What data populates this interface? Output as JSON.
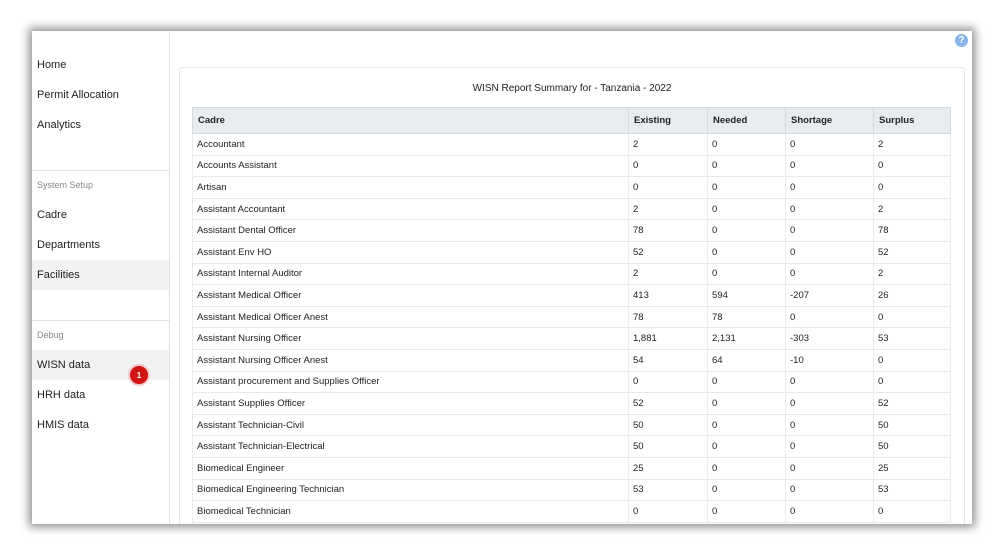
{
  "sidebar": {
    "main_items": [
      {
        "label": "Home"
      },
      {
        "label": "Permit Allocation"
      },
      {
        "label": "Analytics"
      }
    ],
    "system_setup_header": "System Setup",
    "system_setup_items": [
      {
        "label": "Cadre"
      },
      {
        "label": "Departments"
      },
      {
        "label": "Facilities"
      }
    ],
    "debug_header": "Debug",
    "debug_items": [
      {
        "label": "WISN data"
      },
      {
        "label": "HRH data"
      },
      {
        "label": "HMIS data"
      }
    ],
    "badge_count": "1"
  },
  "help_icon": "?",
  "report": {
    "title": "WISN Report Summary for - Tanzania - 2022",
    "columns": [
      "Cadre",
      "Existing",
      "Needed",
      "Shortage",
      "Surplus"
    ],
    "rows": [
      [
        "Accountant",
        "2",
        "0",
        "0",
        "2"
      ],
      [
        "Accounts Assistant",
        "0",
        "0",
        "0",
        "0"
      ],
      [
        "Artisan",
        "0",
        "0",
        "0",
        "0"
      ],
      [
        "Assistant Accountant",
        "2",
        "0",
        "0",
        "2"
      ],
      [
        "Assistant Dental Officer",
        "78",
        "0",
        "0",
        "78"
      ],
      [
        "Assistant Env HO",
        "52",
        "0",
        "0",
        "52"
      ],
      [
        "Assistant Internal Auditor",
        "2",
        "0",
        "0",
        "2"
      ],
      [
        "Assistant Medical Officer",
        "413",
        "594",
        "-207",
        "26"
      ],
      [
        "Assistant Medical Officer Anest",
        "78",
        "78",
        "0",
        "0"
      ],
      [
        "Assistant Nursing Officer",
        "1,881",
        "2,131",
        "-303",
        "53"
      ],
      [
        "Assistant Nursing Officer Anest",
        "54",
        "64",
        "-10",
        "0"
      ],
      [
        "Assistant procurement and Supplies Officer",
        "0",
        "0",
        "0",
        "0"
      ],
      [
        "Assistant Supplies Officer",
        "52",
        "0",
        "0",
        "52"
      ],
      [
        "Assistant Technician-Civil",
        "50",
        "0",
        "0",
        "50"
      ],
      [
        "Assistant Technician-Electrical",
        "50",
        "0",
        "0",
        "50"
      ],
      [
        "Biomedical Engineer",
        "25",
        "0",
        "0",
        "25"
      ],
      [
        "Biomedical Engineering Technician",
        "53",
        "0",
        "0",
        "53"
      ],
      [
        "Biomedical Technician",
        "0",
        "0",
        "0",
        "0"
      ]
    ]
  }
}
